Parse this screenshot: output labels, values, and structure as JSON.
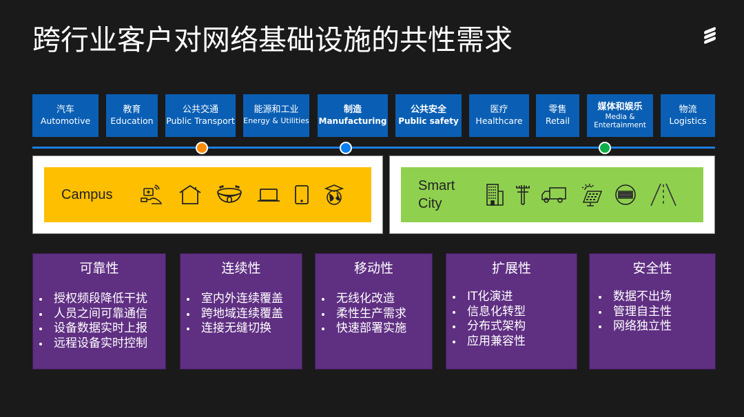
{
  "title": "跨行业客户对网络基础设施的共性需求",
  "logo": "ericsson-logo-icon",
  "industries": [
    {
      "zh": "汽车",
      "en": "Automotive"
    },
    {
      "zh": "教育",
      "en": "Education"
    },
    {
      "zh": "公共交通",
      "en": "Public Transport"
    },
    {
      "zh": "能源和工业",
      "en": "Energy & Utilities"
    },
    {
      "zh": "制造",
      "en": "Manufacturing"
    },
    {
      "zh": "公共安全",
      "en": "Public safety"
    },
    {
      "zh": "医疗",
      "en": "Healthcare"
    },
    {
      "zh": "零售",
      "en": "Retail"
    },
    {
      "zh": "媒体和娱乐",
      "en": "Media &",
      "en2": "Entertainment"
    },
    {
      "zh": "物流",
      "en": "Logistics"
    }
  ],
  "timeline": {
    "markers": [
      {
        "name": "public-transport-marker",
        "color": "#ff8c0a"
      },
      {
        "name": "manufacturing-marker",
        "color": "#0a7ff0"
      },
      {
        "name": "media-marker",
        "color": "#0fb04a"
      }
    ]
  },
  "scenarios": {
    "campus": {
      "label": "Campus",
      "color": "#fdbf00",
      "icons": [
        "remote-healthcare-icon",
        "house-icon",
        "stadium-icon",
        "laptop-icon",
        "tablet-icon",
        "education-globe-icon"
      ]
    },
    "smart_city": {
      "label_line1": "Smart",
      "label_line2": "City",
      "color": "#8fd14f",
      "icons": [
        "building-icon",
        "power-pole-icon",
        "truck-icon",
        "solar-panel-icon",
        "meter-icon",
        "road-icon"
      ]
    }
  },
  "requirements": [
    {
      "title": "可靠性",
      "items": [
        "授权频段降低干扰",
        "人员之间可靠通信",
        "设备数据实时上报",
        "远程设备实时控制"
      ]
    },
    {
      "title": "连续性",
      "items": [
        "室内外连续覆盖",
        "跨地域连续覆盖",
        "连接无缝切换"
      ]
    },
    {
      "title": "移动性",
      "items": [
        "无线化改造",
        "柔性生产需求",
        "快速部署实施"
      ]
    },
    {
      "title": "扩展性",
      "items": [
        "IT化演进",
        "信息化转型",
        "分布式架构",
        "应用兼容性"
      ]
    },
    {
      "title": "安全性",
      "items": [
        "数据不出场",
        "管理自主性",
        "网络独立性"
      ]
    }
  ],
  "colors": {
    "background": "#1a1a1a",
    "tile": "#0a5fb4",
    "timeline": "#1a7fe0",
    "requirement": "#5f2f82"
  }
}
